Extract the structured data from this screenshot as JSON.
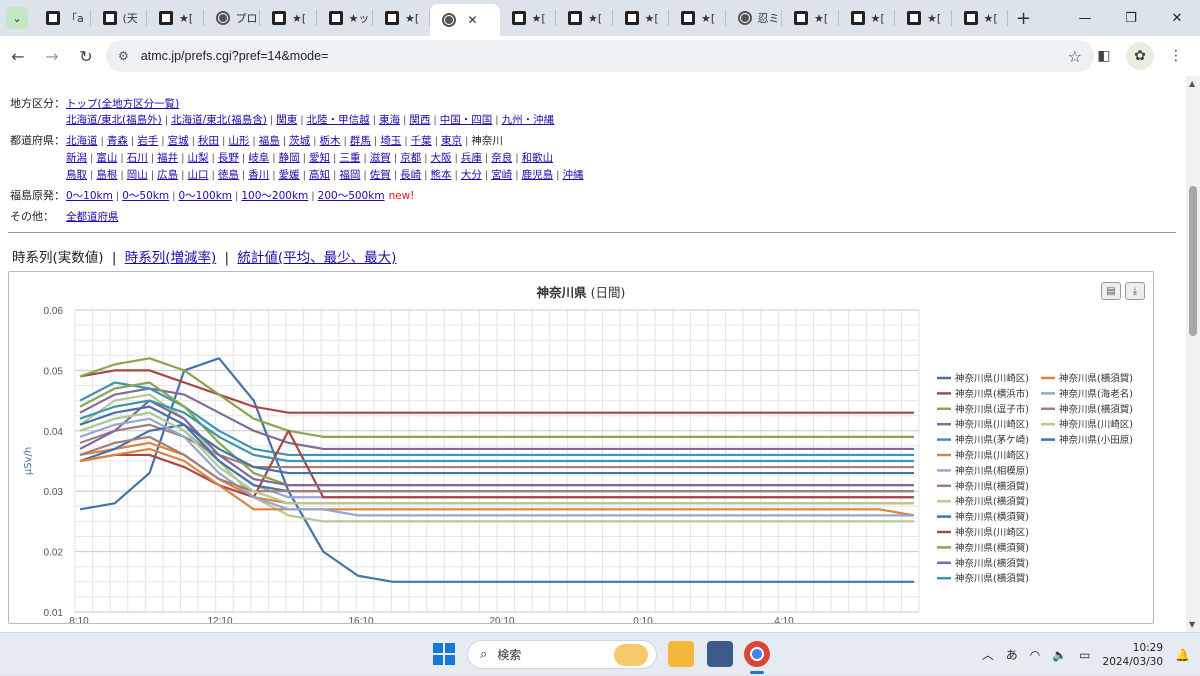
{
  "browser": {
    "tabs": [
      {
        "label": "「a",
        "favicon": "black-square-icon"
      },
      {
        "label": "(天",
        "favicon": "black-square-icon"
      },
      {
        "label": "★[",
        "favicon": "black-square-icon"
      },
      {
        "label": "プロ",
        "favicon": "info-icon"
      },
      {
        "label": "★[",
        "favicon": "black-square-icon"
      },
      {
        "label": "★ッ",
        "favicon": "black-square-icon"
      },
      {
        "label": "★[",
        "favicon": "black-square-icon"
      },
      {
        "label": "",
        "favicon": "globe-icon",
        "active": true
      },
      {
        "label": "★[",
        "favicon": "black-square-icon"
      },
      {
        "label": "★[",
        "favicon": "black-square-icon"
      },
      {
        "label": "★[",
        "favicon": "black-square-icon"
      },
      {
        "label": "★[",
        "favicon": "black-square-icon"
      },
      {
        "label": "忍ミ",
        "favicon": "globe-icon"
      },
      {
        "label": "★[",
        "favicon": "black-square-icon"
      },
      {
        "label": "★[",
        "favicon": "black-square-icon"
      },
      {
        "label": "★[",
        "favicon": "black-square-icon"
      },
      {
        "label": "★[",
        "favicon": "black-square-icon"
      }
    ],
    "url": "atmc.jp/prefs.cgi?pref=14&mode="
  },
  "nav": {
    "region": {
      "label": "地方区分：",
      "line1": [
        "トップ(全地方区分一覧)"
      ],
      "line2": [
        "北海道/東北(福島外)",
        "北海道/東北(福島含)",
        "関東",
        "北陸・甲信越",
        "東海",
        "関西",
        "中国・四国",
        "九州・沖縄"
      ]
    },
    "prefs": {
      "label": "都道府県：",
      "line1": [
        "北海道",
        "青森",
        "岩手",
        "宮城",
        "秋田",
        "山形",
        "福島",
        "茨城",
        "栃木",
        "群馬",
        "埼玉",
        "千葉",
        "東京"
      ],
      "current": "神奈川",
      "line2": [
        "新潟",
        "富山",
        "石川",
        "福井",
        "山梨",
        "長野",
        "岐阜",
        "静岡",
        "愛知",
        "三重",
        "滋賀",
        "京都",
        "大阪",
        "兵庫",
        "奈良",
        "和歌山"
      ],
      "line3": [
        "鳥取",
        "島根",
        "岡山",
        "広島",
        "山口",
        "徳島",
        "香川",
        "愛媛",
        "高知",
        "福岡",
        "佐賀",
        "長崎",
        "熊本",
        "大分",
        "宮崎",
        "鹿児島",
        "沖縄"
      ]
    },
    "fukushima": {
      "label": "福島原発：",
      "items": [
        "0～10km",
        "0～50km",
        "0～100km",
        "100～200km",
        "200～500km"
      ],
      "new_tag": "new!"
    },
    "other": {
      "label": "その他：",
      "items": [
        "全都道府県"
      ]
    }
  },
  "modes": {
    "current": "時系列(実数値)",
    "link1": "時系列(増減率)",
    "link2": "統計値(平均、最少、最大)",
    "separator": "|"
  },
  "chart_data": {
    "type": "line",
    "title": "神奈川県",
    "subtitle": "(日間)",
    "ylabel": "μSv/h",
    "ylim": [
      0.01,
      0.06
    ],
    "yticks": [
      "0.06",
      "0.05",
      "0.04",
      "0.03",
      "0.02",
      "0.01"
    ],
    "xticks": [
      "8:10",
      "12:10",
      "16:10",
      "20:10",
      "0:10",
      "4:10"
    ],
    "grid": true,
    "legend_placement": "right",
    "series": [
      {
        "name": "神奈川県(川崎区)",
        "color": "#4572a7",
        "values": [
          0.027,
          0.028,
          0.033,
          0.05,
          0.052,
          0.045,
          0.03,
          0.02,
          0.016,
          0.015,
          0.015,
          0.015,
          0.015,
          0.015,
          0.015,
          0.015,
          0.015,
          0.015,
          0.015,
          0.015,
          0.015,
          0.015,
          0.015,
          0.015,
          0.015
        ]
      },
      {
        "name": "神奈川県(横浜市)",
        "color": "#aa4643",
        "values": [
          0.049,
          0.05,
          0.05,
          0.048,
          0.046,
          0.044,
          0.043,
          0.043,
          0.043,
          0.043,
          0.043,
          0.043,
          0.043,
          0.043,
          0.043,
          0.043,
          0.043,
          0.043,
          0.043,
          0.043,
          0.043,
          0.043,
          0.043,
          0.043,
          0.043
        ]
      },
      {
        "name": "神奈川県(逗子市)",
        "color": "#89a54e",
        "values": [
          0.049,
          0.051,
          0.052,
          0.05,
          0.046,
          0.042,
          0.04,
          0.039,
          0.039,
          0.039,
          0.039,
          0.039,
          0.039,
          0.039,
          0.039,
          0.039,
          0.039,
          0.039,
          0.039,
          0.039,
          0.039,
          0.039,
          0.039,
          0.039,
          0.039
        ]
      },
      {
        "name": "神奈川県(川崎区)",
        "color": "#80699b",
        "values": [
          0.043,
          0.046,
          0.047,
          0.046,
          0.043,
          0.04,
          0.038,
          0.037,
          0.037,
          0.037,
          0.037,
          0.037,
          0.037,
          0.037,
          0.037,
          0.037,
          0.037,
          0.037,
          0.037,
          0.037,
          0.037,
          0.037,
          0.037,
          0.037,
          0.037
        ]
      },
      {
        "name": "神奈川県(茅ケ崎)",
        "color": "#3d96ae",
        "values": [
          0.045,
          0.048,
          0.047,
          0.044,
          0.04,
          0.037,
          0.036,
          0.036,
          0.036,
          0.036,
          0.036,
          0.036,
          0.036,
          0.036,
          0.036,
          0.036,
          0.036,
          0.036,
          0.036,
          0.036,
          0.036,
          0.036,
          0.036,
          0.036,
          0.036
        ]
      },
      {
        "name": "神奈川県(川崎区)",
        "color": "#db843d",
        "values": [
          0.036,
          0.037,
          0.038,
          0.036,
          0.032,
          0.029,
          0.028,
          0.028,
          0.028,
          0.028,
          0.028,
          0.028,
          0.028,
          0.028,
          0.028,
          0.028,
          0.028,
          0.028,
          0.028,
          0.028,
          0.028,
          0.028,
          0.028,
          0.028,
          0.028
        ]
      },
      {
        "name": "神奈川県(相模原)",
        "color": "#92a8cd",
        "values": [
          0.04,
          0.042,
          0.043,
          0.04,
          0.035,
          0.031,
          0.029,
          0.029,
          0.029,
          0.029,
          0.029,
          0.029,
          0.029,
          0.029,
          0.029,
          0.029,
          0.029,
          0.029,
          0.029,
          0.029,
          0.029,
          0.029,
          0.029,
          0.029,
          0.029
        ]
      },
      {
        "name": "神奈川県(横須賀)",
        "color": "#a47d7c",
        "values": [
          0.038,
          0.04,
          0.041,
          0.039,
          0.036,
          0.034,
          0.034,
          0.034,
          0.034,
          0.034,
          0.034,
          0.034,
          0.034,
          0.034,
          0.034,
          0.034,
          0.034,
          0.034,
          0.034,
          0.034,
          0.034,
          0.034,
          0.034,
          0.034,
          0.034
        ]
      },
      {
        "name": "神奈川県(横須賀)",
        "color": "#b5ca92",
        "values": [
          0.041,
          0.045,
          0.046,
          0.042,
          0.035,
          0.029,
          0.026,
          0.025,
          0.025,
          0.025,
          0.025,
          0.025,
          0.025,
          0.025,
          0.025,
          0.025,
          0.025,
          0.025,
          0.025,
          0.025,
          0.025,
          0.025,
          0.025,
          0.025,
          0.025
        ]
      },
      {
        "name": "神奈川県(横須賀)",
        "color": "#4572a7",
        "values": [
          0.035,
          0.037,
          0.04,
          0.041,
          0.035,
          0.031,
          0.03,
          0.03,
          0.03,
          0.03,
          0.03,
          0.03,
          0.03,
          0.03,
          0.03,
          0.03,
          0.03,
          0.03,
          0.03,
          0.03,
          0.03,
          0.03,
          0.03,
          0.03,
          0.03
        ]
      },
      {
        "name": "神奈川県(川崎区)",
        "color": "#aa4643",
        "values": [
          0.035,
          0.036,
          0.036,
          0.034,
          0.031,
          0.029,
          0.04,
          0.029,
          0.029,
          0.029,
          0.029,
          0.029,
          0.029,
          0.029,
          0.029,
          0.029,
          0.029,
          0.029,
          0.029,
          0.029,
          0.029,
          0.029,
          0.029,
          0.029,
          0.029
        ]
      },
      {
        "name": "神奈川県(横須賀)",
        "color": "#89a54e",
        "values": [
          0.044,
          0.047,
          0.048,
          0.044,
          0.038,
          0.033,
          0.031,
          0.031,
          0.031,
          0.031,
          0.031,
          0.031,
          0.031,
          0.031,
          0.031,
          0.031,
          0.031,
          0.031,
          0.031,
          0.031,
          0.031,
          0.031,
          0.031,
          0.031,
          0.031
        ]
      },
      {
        "name": "神奈川県(横須賀)",
        "color": "#80699b",
        "values": [
          0.037,
          0.04,
          0.045,
          0.042,
          0.036,
          0.032,
          0.031,
          0.031,
          0.031,
          0.031,
          0.031,
          0.031,
          0.031,
          0.031,
          0.031,
          0.031,
          0.031,
          0.031,
          0.031,
          0.031,
          0.031,
          0.031,
          0.031,
          0.031,
          0.031
        ]
      },
      {
        "name": "神奈川県(横須賀)",
        "color": "#3d96ae",
        "values": [
          0.042,
          0.044,
          0.045,
          0.043,
          0.039,
          0.036,
          0.035,
          0.035,
          0.035,
          0.035,
          0.035,
          0.035,
          0.035,
          0.035,
          0.035,
          0.035,
          0.035,
          0.035,
          0.035,
          0.035,
          0.035,
          0.035,
          0.035,
          0.035,
          0.035
        ]
      },
      {
        "name": "神奈川県(横須賀)",
        "color": "#db843d",
        "values": [
          0.035,
          0.036,
          0.037,
          0.035,
          0.031,
          0.027,
          0.027,
          0.027,
          0.027,
          0.027,
          0.027,
          0.027,
          0.027,
          0.027,
          0.027,
          0.027,
          0.027,
          0.027,
          0.027,
          0.027,
          0.027,
          0.027,
          0.027,
          0.027,
          0.026
        ]
      },
      {
        "name": "神奈川県(海老名)",
        "color": "#92a8cd",
        "values": [
          0.039,
          0.041,
          0.042,
          0.039,
          0.033,
          0.029,
          0.027,
          0.027,
          0.026,
          0.026,
          0.026,
          0.026,
          0.026,
          0.026,
          0.026,
          0.026,
          0.026,
          0.026,
          0.026,
          0.026,
          0.026,
          0.026,
          0.026,
          0.026,
          0.026
        ]
      },
      {
        "name": "神奈川県(横須賀)",
        "color": "#a47d7c",
        "values": [
          0.036,
          0.038,
          0.039,
          0.036,
          0.032,
          0.03,
          0.03,
          0.03,
          0.03,
          0.03,
          0.03,
          0.03,
          0.03,
          0.03,
          0.03,
          0.03,
          0.03,
          0.03,
          0.03,
          0.03,
          0.03,
          0.03,
          0.03,
          0.03,
          0.03
        ]
      },
      {
        "name": "神奈川県(川崎区)",
        "color": "#b5ca92",
        "values": [
          0.04,
          0.042,
          0.043,
          0.04,
          0.034,
          0.03,
          0.028,
          0.028,
          0.028,
          0.028,
          0.028,
          0.028,
          0.028,
          0.028,
          0.028,
          0.028,
          0.028,
          0.028,
          0.028,
          0.028,
          0.028,
          0.028,
          0.028,
          0.028,
          0.028
        ]
      },
      {
        "name": "神奈川県(小田原)",
        "color": "#4572a7",
        "values": [
          0.041,
          0.043,
          0.044,
          0.041,
          0.037,
          0.034,
          0.033,
          0.033,
          0.033,
          0.033,
          0.033,
          0.033,
          0.033,
          0.033,
          0.033,
          0.033,
          0.033,
          0.033,
          0.033,
          0.033,
          0.033,
          0.033,
          0.033,
          0.033,
          0.033
        ]
      }
    ]
  },
  "taskbar": {
    "search_placeholder": "検索",
    "ime": "あ",
    "time": "10:29",
    "date": "2024/03/30"
  }
}
